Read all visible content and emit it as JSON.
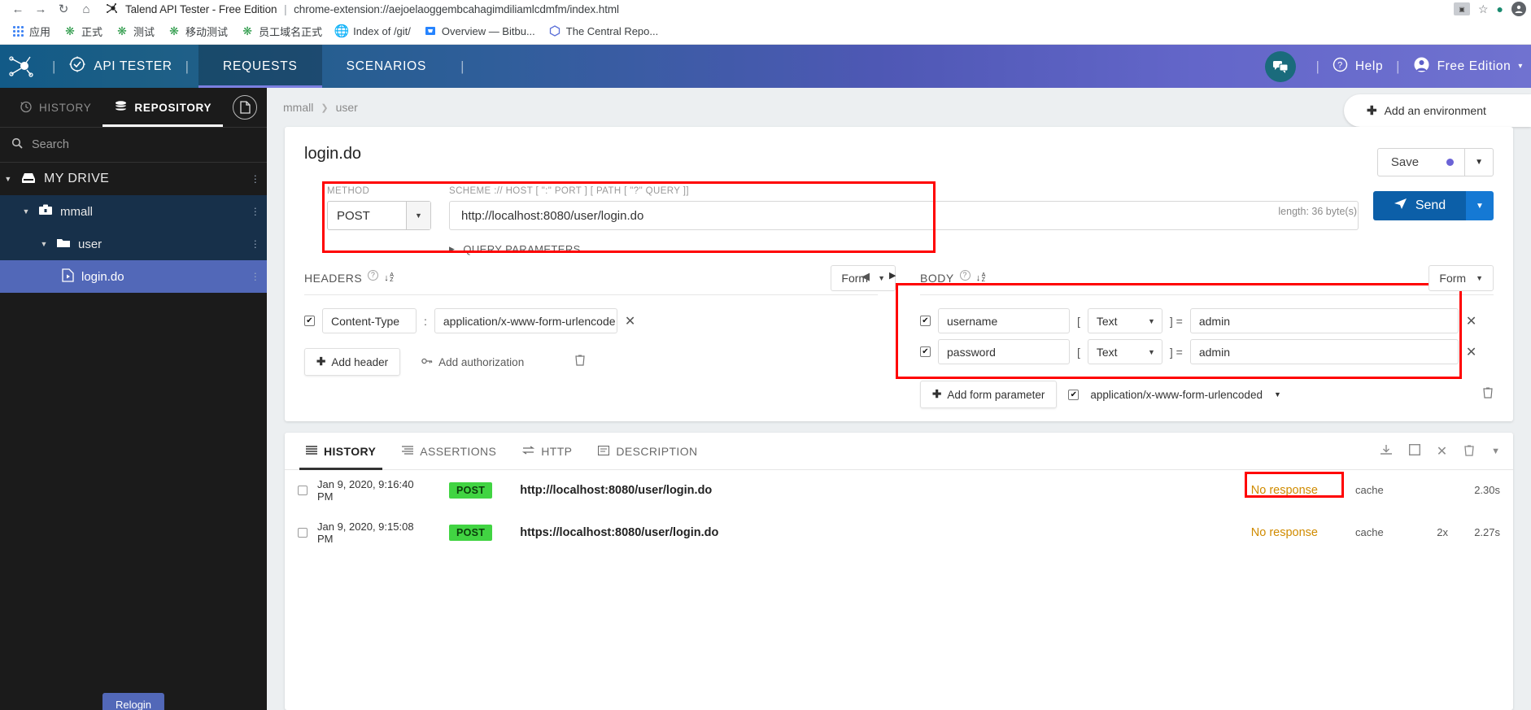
{
  "browser": {
    "tab_title": "Talend API Tester - Free Edition",
    "tab_url": "chrome-extension://aejoelaoggembcahagimdiliamlcdmfm/index.html",
    "bookmarks": [
      {
        "label": "应用",
        "icon": "apps-grid-icon"
      },
      {
        "label": "正式",
        "icon": "puzzle-icon"
      },
      {
        "label": "测试",
        "icon": "puzzle-icon"
      },
      {
        "label": "移动测试",
        "icon": "puzzle-icon"
      },
      {
        "label": "员工域名正式",
        "icon": "puzzle-icon"
      },
      {
        "label": "Index of /git/",
        "icon": "globe-icon"
      },
      {
        "label": "Overview — Bitbu...",
        "icon": "bitbucket-icon"
      },
      {
        "label": "The Central Repo...",
        "icon": "hexagon-icon"
      }
    ]
  },
  "app_header": {
    "brand": "API TESTER",
    "tabs": [
      {
        "label": "REQUESTS",
        "active": true
      },
      {
        "label": "SCENARIOS",
        "active": false
      }
    ],
    "help_label": "Help",
    "account_label": "Free Edition"
  },
  "sidebar": {
    "tabs": [
      {
        "label": "HISTORY",
        "icon": "clock-icon",
        "active": false
      },
      {
        "label": "REPOSITORY",
        "icon": "database-icon",
        "active": true
      }
    ],
    "doc_button": "document-icon",
    "search_placeholder": "Search",
    "tree": [
      {
        "label": "MY DRIVE",
        "level": 0,
        "icon": "drive-icon",
        "expanded": true,
        "selected": false
      },
      {
        "label": "mmall",
        "level": 1,
        "icon": "project-icon",
        "expanded": true,
        "selected": false
      },
      {
        "label": "user",
        "level": 2,
        "icon": "folder-icon",
        "expanded": true,
        "selected": false
      },
      {
        "label": "login.do",
        "level": 3,
        "icon": "request-icon",
        "expanded": false,
        "selected": true
      }
    ],
    "relogin_label": "Relogin"
  },
  "breadcrumb": {
    "items": [
      "mmall",
      "user"
    ],
    "separator": "›"
  },
  "environment": {
    "add_label": "Add an environment",
    "plus": "➕"
  },
  "request": {
    "title": "login.do",
    "save_label": "Save",
    "method_label": "METHOD",
    "method_value": "POST",
    "url_label": "SCHEME :// HOST [ \":\" PORT ] [ PATH [ \"?\" QUERY ]]",
    "url_value": "http://localhost:8080/user/login.do",
    "send_label": "Send",
    "length_note": "length: 36 byte(s)",
    "query_parameters_label": "QUERY PARAMETERS"
  },
  "headers_panel": {
    "title": "HEADERS",
    "mode": "Form",
    "rows": [
      {
        "checked": true,
        "name": "Content-Type",
        "value": "application/x-www-form-urlencode"
      }
    ],
    "add_header_label": "Add header",
    "add_authorization_label": "Add authorization"
  },
  "body_panel": {
    "title": "BODY",
    "mode": "Form",
    "rows": [
      {
        "checked": true,
        "name": "username",
        "type": "Text",
        "value": "admin"
      },
      {
        "checked": true,
        "name": "password",
        "type": "Text",
        "value": "admin"
      }
    ],
    "add_param_label": "Add form parameter",
    "content_type_checked": true,
    "content_type_value": "application/x-www-form-urlencoded"
  },
  "response_panel": {
    "tabs": [
      {
        "label": "HISTORY",
        "icon": "list-icon",
        "active": true
      },
      {
        "label": "ASSERTIONS",
        "icon": "assert-icon",
        "active": false
      },
      {
        "label": "HTTP",
        "icon": "exchange-icon",
        "active": false
      },
      {
        "label": "DESCRIPTION",
        "icon": "note-icon",
        "active": false
      }
    ],
    "columns": [
      "date",
      "method",
      "url",
      "status",
      "cache",
      "repeat",
      "time"
    ],
    "rows": [
      {
        "date": "Jan 9, 2020, 9:16:40 PM",
        "method": "POST",
        "url": "http://localhost:8080/user/login.do",
        "status": "No response",
        "cache": "cache",
        "repeat": "",
        "time": "2.30s",
        "highlighted": true
      },
      {
        "date": "Jan 9, 2020, 9:15:08 PM",
        "method": "POST",
        "url": "https://localhost:8080/user/login.do",
        "status": "No response",
        "cache": "cache",
        "repeat": "2x",
        "time": "2.27s",
        "highlighted": false
      }
    ],
    "tools": [
      "download-icon",
      "window-icon",
      "close-icon",
      "trash-icon",
      "chevron-down-icon"
    ]
  },
  "colors": {
    "accent_purple": "#6b63d6",
    "send_blue": "#0c5fa8",
    "post_green": "#41d442",
    "status_amber": "#d08b00",
    "annotation_red": "#ff0000",
    "selected_row": "#5268b8"
  }
}
